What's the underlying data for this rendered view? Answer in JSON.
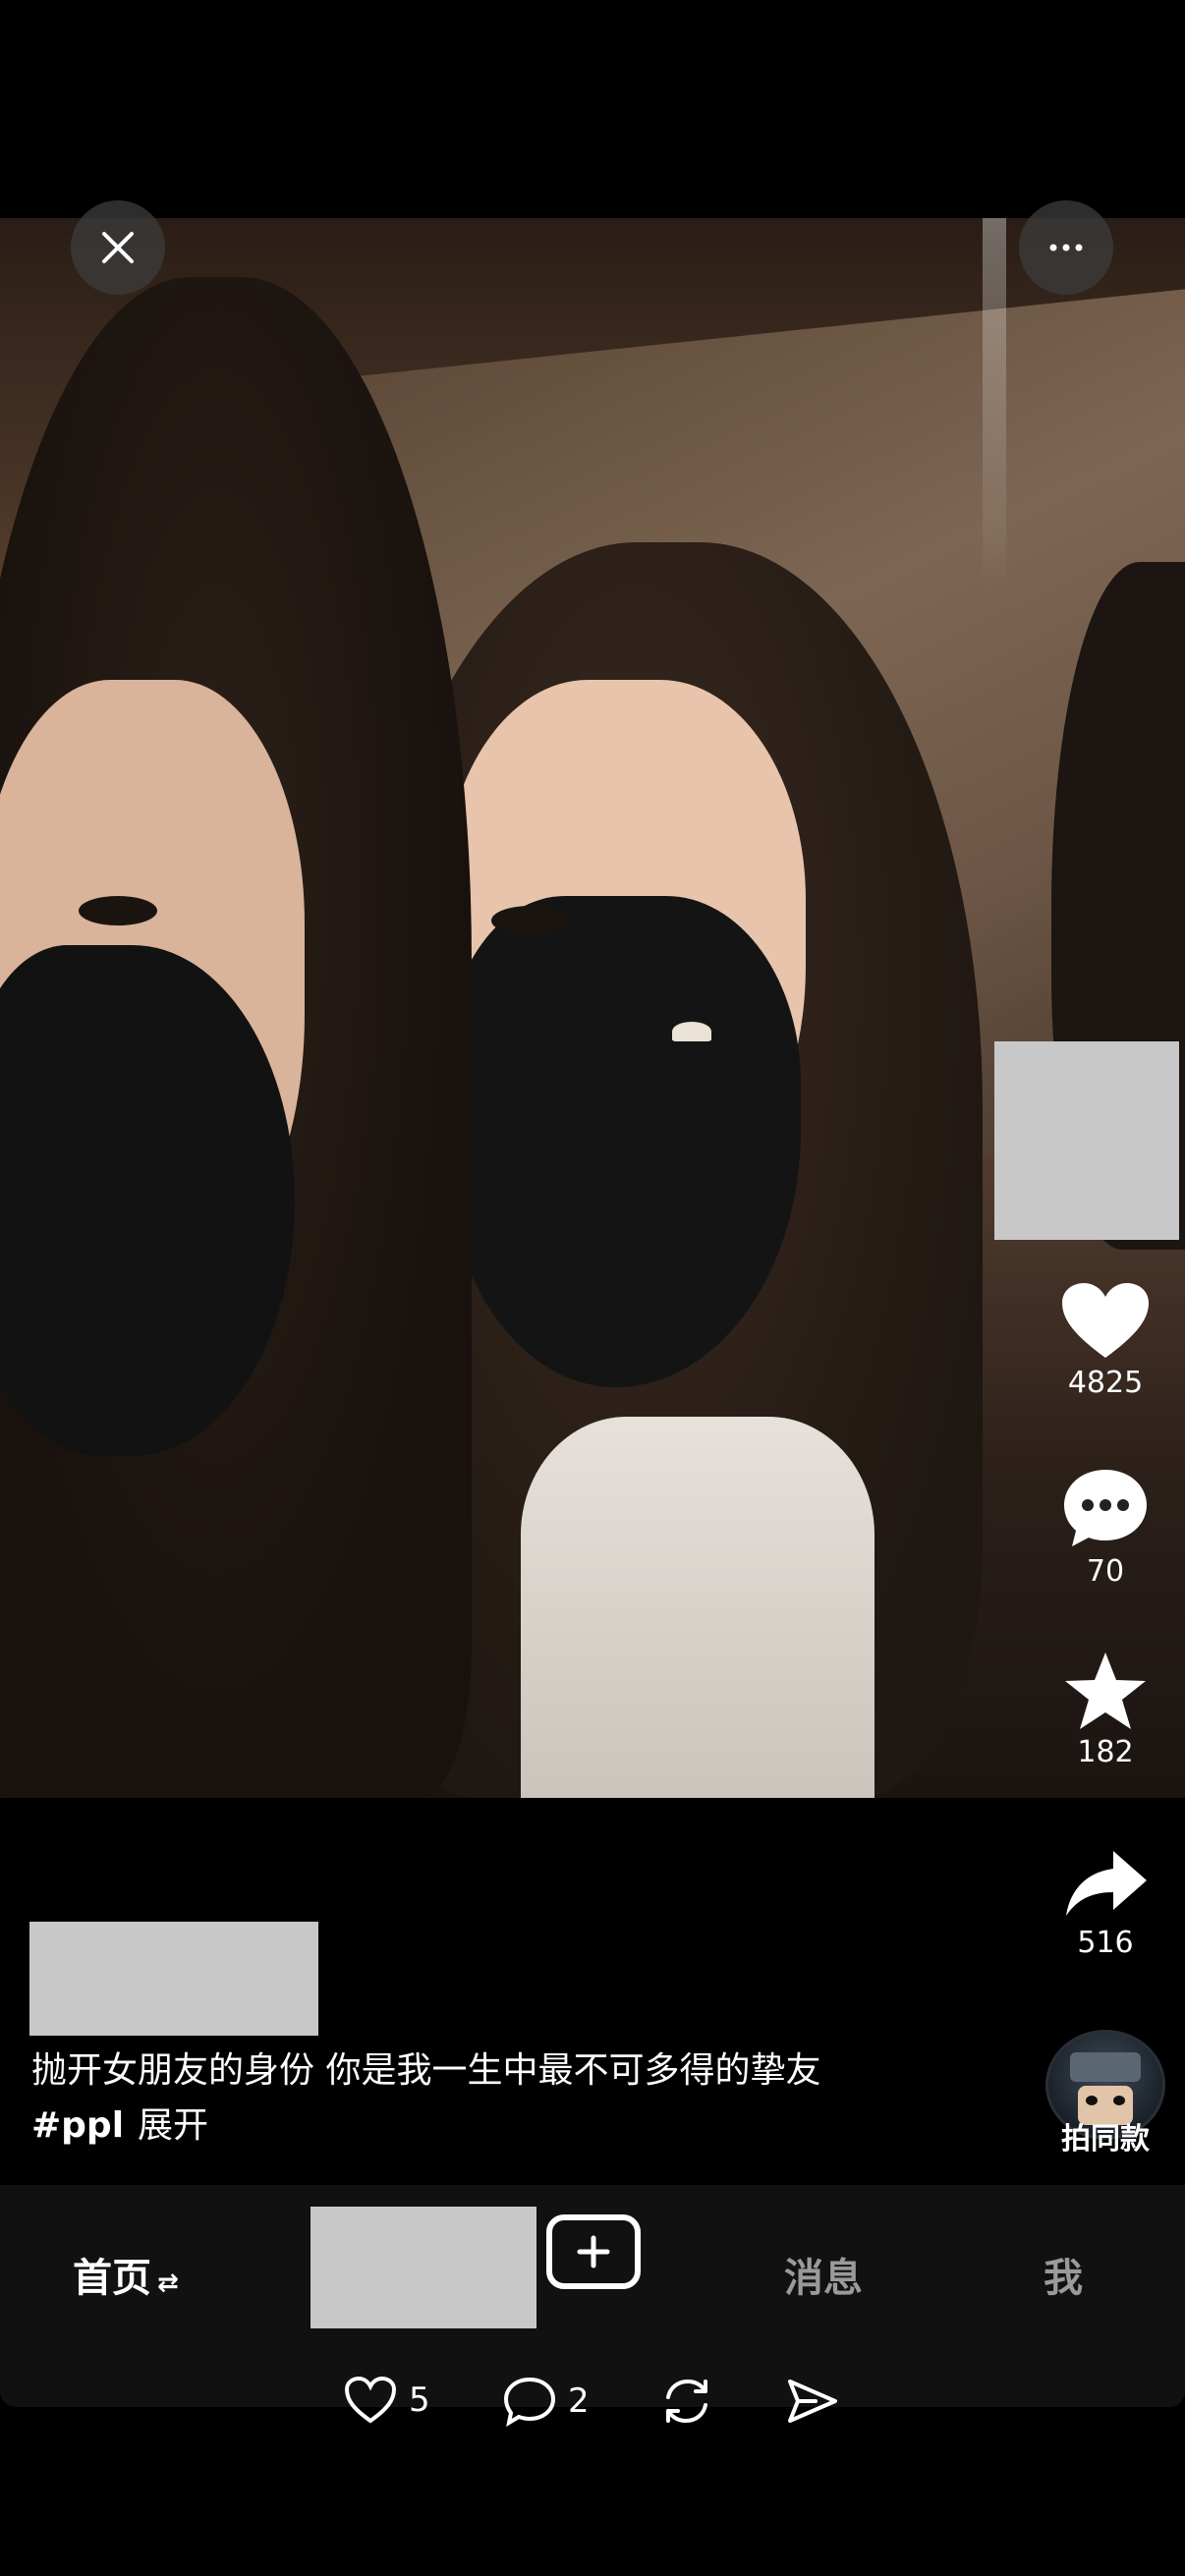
{
  "top": {
    "close_icon": "close-icon",
    "more_icon": "more-icon"
  },
  "rail": {
    "like_count": "4825",
    "comment_count": "70",
    "favorite_count": "182",
    "share_count": "516"
  },
  "caption": {
    "text": "抛开女朋友的身份 你是我一生中最不可多得的挚友",
    "hashtag": "#ppl",
    "expand": "展开"
  },
  "same_style": {
    "label": "拍同款"
  },
  "nav": {
    "home": "首页",
    "home_swap": "⇄",
    "messages": "消息",
    "me": "我"
  },
  "actions": {
    "likes": "5",
    "comments": "2"
  }
}
